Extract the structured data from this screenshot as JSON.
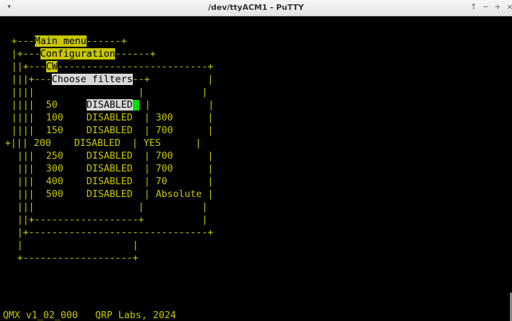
{
  "window": {
    "title": "/dev/ttyACM1 - PuTTY",
    "menu_glyph": "▾",
    "btn_up": "↑",
    "btn_min": "−",
    "btn_max": "+",
    "btn_close": "×"
  },
  "terminal": {
    "menu": {
      "main": "Main menu",
      "configuration": "Configuration",
      "cw": "CW",
      "choose_filters": "Choose filters"
    },
    "rows": [
      {
        "bw": "50",
        "status": "DISABLED",
        "value": ""
      },
      {
        "bw": "100",
        "status": "DISABLED",
        "value": "300"
      },
      {
        "bw": "150",
        "status": "DISABLED",
        "value": "700"
      },
      {
        "bw": "200",
        "status": "DISABLED",
        "value": "YES"
      },
      {
        "bw": "250",
        "status": "DISABLED",
        "value": "700"
      },
      {
        "bw": "300",
        "status": "DISABLED",
        "value": "700"
      },
      {
        "bw": "400",
        "status": "DISABLED",
        "value": "70"
      },
      {
        "bw": "500",
        "status": "DISABLED",
        "value": "Absolute"
      }
    ],
    "status_line": "QMX v1_02_000   QRP Labs, 2024"
  },
  "colors": {
    "terminal_bg": "#000000",
    "terminal_fg": "#c7c700",
    "cursor": "#00e000"
  }
}
